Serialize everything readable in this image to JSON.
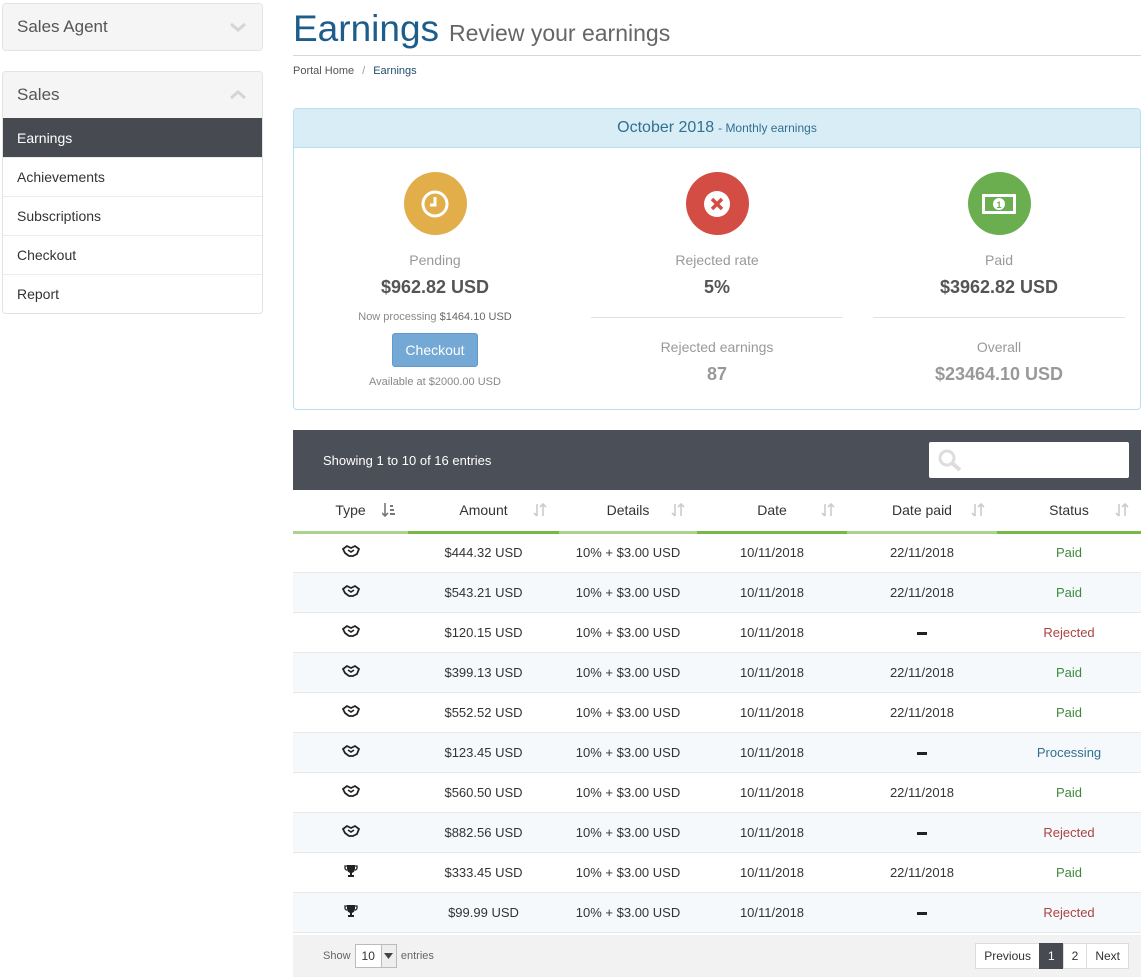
{
  "sidebar": {
    "agent_title": "Sales Agent",
    "sales_title": "Sales",
    "items": [
      {
        "label": "Earnings"
      },
      {
        "label": "Achievements"
      },
      {
        "label": "Subscriptions"
      },
      {
        "label": "Checkout"
      },
      {
        "label": "Report"
      }
    ]
  },
  "header": {
    "title": "Earnings",
    "subtitle": "Review your earnings",
    "breadcrumb": {
      "home": "Portal Home",
      "separator": "/",
      "current": "Earnings"
    }
  },
  "summary": {
    "month": "October 2018",
    "note": "- Monthly earnings",
    "pending": {
      "label": "Pending",
      "value": "$962.82 USD",
      "processing_prefix": "Now processing",
      "processing_value": "$1464.10 USD",
      "button": "Checkout",
      "available": "Available at $2000.00 USD"
    },
    "rejected": {
      "rate_label": "Rejected rate",
      "rate_value": "5%",
      "earnings_label": "Rejected earnings",
      "earnings_value": "87"
    },
    "paid": {
      "label": "Paid",
      "value": "$3962.82 USD",
      "overall_label": "Overall",
      "overall_value": "$23464.10 USD"
    },
    "colors": {
      "pending": "#e2ae4a",
      "rejected": "#d44d45",
      "paid": "#6aae4f"
    }
  },
  "table": {
    "info": "Showing 1 to 10 of 16 entries",
    "search_placeholder": "",
    "columns": [
      "Type",
      "Amount",
      "Details",
      "Date",
      "Date paid",
      "Status"
    ],
    "rows": [
      {
        "type": "handshake-icon",
        "amount": "$444.32 USD",
        "details": "10% + $3.00 USD",
        "date": "10/11/2018",
        "date_paid": "22/11/2018",
        "status": "Paid",
        "status_kind": "paid"
      },
      {
        "type": "handshake-icon",
        "amount": "$543.21 USD",
        "details": "10% + $3.00 USD",
        "date": "10/11/2018",
        "date_paid": "22/11/2018",
        "status": "Paid",
        "status_kind": "paid"
      },
      {
        "type": "handshake-icon",
        "amount": "$120.15 USD",
        "details": "10% + $3.00 USD",
        "date": "10/11/2018",
        "date_paid": "",
        "status": "Rejected",
        "status_kind": "rejected"
      },
      {
        "type": "handshake-icon",
        "amount": "$399.13 USD",
        "details": "10% + $3.00 USD",
        "date": "10/11/2018",
        "date_paid": "22/11/2018",
        "status": "Paid",
        "status_kind": "paid"
      },
      {
        "type": "handshake-icon",
        "amount": "$552.52 USD",
        "details": "10% + $3.00 USD",
        "date": "10/11/2018",
        "date_paid": "22/11/2018",
        "status": "Paid",
        "status_kind": "paid"
      },
      {
        "type": "handshake-icon",
        "amount": "$123.45 USD",
        "details": "10% + $3.00 USD",
        "date": "10/11/2018",
        "date_paid": "",
        "status": "Processing",
        "status_kind": "processing"
      },
      {
        "type": "handshake-icon",
        "amount": "$560.50 USD",
        "details": "10% + $3.00 USD",
        "date": "10/11/2018",
        "date_paid": "22/11/2018",
        "status": "Paid",
        "status_kind": "paid"
      },
      {
        "type": "handshake-icon",
        "amount": "$882.56 USD",
        "details": "10% + $3.00 USD",
        "date": "10/11/2018",
        "date_paid": "",
        "status": "Rejected",
        "status_kind": "rejected"
      },
      {
        "type": "trophy-icon",
        "amount": "$333.45 USD",
        "details": "10% + $3.00 USD",
        "date": "10/11/2018",
        "date_paid": "22/11/2018",
        "status": "Paid",
        "status_kind": "paid"
      },
      {
        "type": "trophy-icon",
        "amount": "$99.99 USD",
        "details": "10% + $3.00 USD",
        "date": "10/11/2018",
        "date_paid": "",
        "status": "Rejected",
        "status_kind": "rejected"
      }
    ]
  },
  "footer": {
    "show_label": "Show",
    "page_size": "10",
    "entries_label": "entries",
    "pagination": {
      "previous": "Previous",
      "pages": [
        "1",
        "2"
      ],
      "next": "Next",
      "current": "1"
    }
  }
}
